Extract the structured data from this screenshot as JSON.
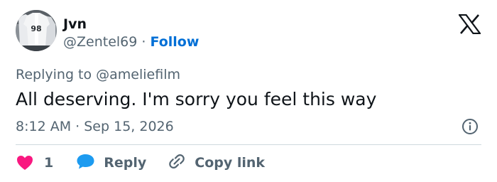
{
  "author": {
    "name": "Jvn",
    "handle": "@Zentel69",
    "separator": "·",
    "follow_label": "Follow",
    "avatar_icon": "avatar-jersey-image"
  },
  "brand": {
    "logo_icon": "x-logo-icon"
  },
  "reply_context": {
    "text": "Replying to @ameliefilm"
  },
  "tweet": {
    "text": "All deserving. I'm sorry you feel this way",
    "time": "8:12 AM",
    "separator": "·",
    "date": "Sep 15, 2026"
  },
  "actions": {
    "like": {
      "icon": "heart-icon",
      "count": "1"
    },
    "reply": {
      "icon": "reply-bubble-icon",
      "label": "Reply"
    },
    "copy": {
      "icon": "link-icon",
      "label": "Copy link"
    },
    "info": {
      "icon": "info-icon"
    }
  },
  "colors": {
    "accent": "#006fd6",
    "heart": "#f91880",
    "reply": "#1d9bf0",
    "muted": "#536471",
    "text": "#0f1419",
    "divider": "#cfd9de"
  }
}
